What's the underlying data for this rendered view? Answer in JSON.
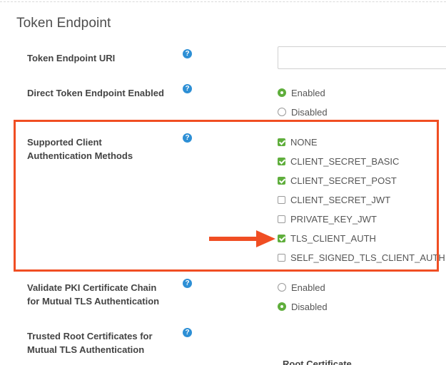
{
  "section": {
    "title": "Token Endpoint"
  },
  "colors": {
    "accent_green": "#5fae3c",
    "help_blue": "#2d8fd5",
    "highlight_orange": "#f04e23"
  },
  "fields": {
    "token_endpoint_uri": {
      "label": "Token Endpoint URI",
      "value": "",
      "help_icon": "question-circle-icon"
    },
    "direct_token_endpoint_enabled": {
      "label": "Direct Token Endpoint Enabled",
      "help_icon": "question-circle-icon",
      "options": [
        {
          "label": "Enabled",
          "selected": true
        },
        {
          "label": "Disabled",
          "selected": false
        }
      ]
    },
    "supported_client_auth_methods": {
      "label_line1": "Supported Client",
      "label_line2": "Authentication Methods",
      "help_icon": "question-circle-icon",
      "options": [
        {
          "label": "NONE",
          "checked": true
        },
        {
          "label": "CLIENT_SECRET_BASIC",
          "checked": true
        },
        {
          "label": "CLIENT_SECRET_POST",
          "checked": true
        },
        {
          "label": "CLIENT_SECRET_JWT",
          "checked": false
        },
        {
          "label": "PRIVATE_KEY_JWT",
          "checked": false
        },
        {
          "label": "TLS_CLIENT_AUTH",
          "checked": true
        },
        {
          "label": "SELF_SIGNED_TLS_CLIENT_AUTH",
          "checked": false
        }
      ]
    },
    "validate_pki_chain": {
      "label_line1": "Validate PKI Certificate Chain",
      "label_line2": "for Mutual TLS Authentication",
      "help_icon": "question-circle-icon",
      "options": [
        {
          "label": "Enabled",
          "selected": false
        },
        {
          "label": "Disabled",
          "selected": true
        }
      ]
    },
    "trusted_root_certs": {
      "label_line1": "Trusted Root Certificates for",
      "label_line2": "Mutual TLS Authentication",
      "help_icon": "question-circle-icon",
      "column_header": "Root Certificate"
    }
  }
}
